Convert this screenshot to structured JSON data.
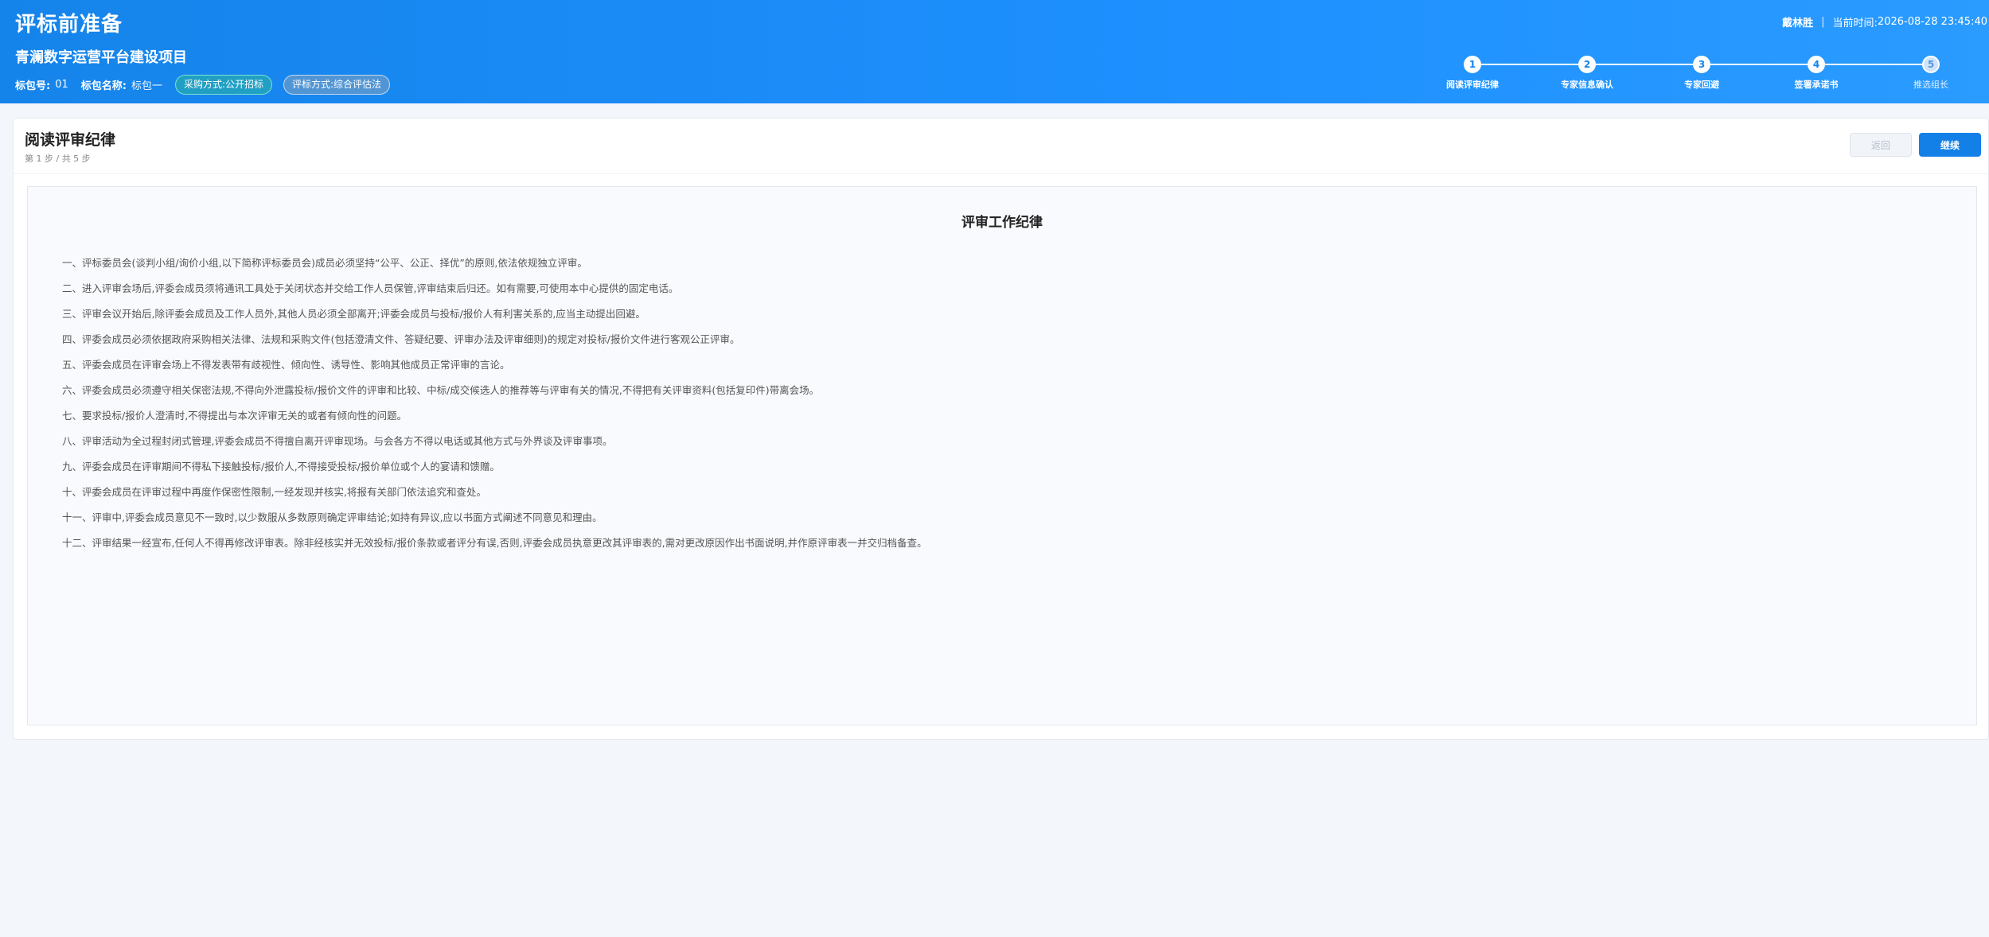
{
  "app": {
    "title": "评标前准备",
    "user": "戴林胜",
    "time_label": "当前时间:",
    "time_value": "2026-08-28 23:45:40"
  },
  "project": {
    "name": "青澜数字运营平台建设项目",
    "package_no_label": "标包号:",
    "package_no": "01",
    "package_name_label": "标包名称:",
    "package_name": "标包一",
    "procurement_method": "采购方式:公开招标",
    "evaluation_method": "评标方式:综合评估法"
  },
  "steps": [
    {
      "num": "1",
      "label": "阅读评审纪律",
      "state": "active"
    },
    {
      "num": "2",
      "label": "专家信息确认",
      "state": "active"
    },
    {
      "num": "3",
      "label": "专家回避",
      "state": "active"
    },
    {
      "num": "4",
      "label": "签署承诺书",
      "state": "active"
    },
    {
      "num": "5",
      "label": "推选组长",
      "state": "pending"
    }
  ],
  "card": {
    "title": "阅读评审纪律",
    "subtitle": "第 1 步 / 共 5 步",
    "back_label": "返回",
    "continue_label": "继续"
  },
  "document": {
    "title": "评审工作纪律",
    "rules": [
      "一、评标委员会(谈判小组/询价小组,以下简称评标委员会)成员必须坚持“公平、公正、择优”的原则,依法依规独立评审。",
      "二、进入评审会场后,评委会成员须将通讯工具处于关闭状态并交给工作人员保管,评审结束后归还。如有需要,可使用本中心提供的固定电话。",
      "三、评审会议开始后,除评委会成员及工作人员外,其他人员必须全部离开;评委会成员与投标/报价人有利害关系的,应当主动提出回避。",
      "四、评委会成员必须依据政府采购相关法律、法规和采购文件(包括澄清文件、答疑纪要、评审办法及评审细则)的规定对投标/报价文件进行客观公正评审。",
      "五、评委会成员在评审会场上不得发表带有歧视性、倾向性、诱导性、影响其他成员正常评审的言论。",
      "六、评委会成员必须遵守相关保密法规,不得向外泄露投标/报价文件的评审和比较、中标/成交候选人的推荐等与评审有关的情况,不得把有关评审资料(包括复印件)带离会场。",
      "七、要求投标/报价人澄清时,不得提出与本次评审无关的或者有倾向性的问题。",
      "八、评审活动为全过程封闭式管理,评委会成员不得擅自离开评审现场。与会各方不得以电话或其他方式与外界谈及评审事项。",
      "九、评委会成员在评审期间不得私下接触投标/报价人,不得接受投标/报价单位或个人的宴请和馈赠。",
      "十、评委会成员在评审过程中再度作保密性限制,一经发现并核实,将报有关部门依法追究和查处。",
      "十一、评审中,评委会成员意见不一致时,以少数服从多数原则确定评审结论;如持有异议,应以书面方式阐述不同意见和理由。",
      "十二、评审结果一经宣布,任何人不得再修改评审表。除非经核实并无效投标/报价条款或者评分有误,否则,评委会成员执意更改其评审表的,需对更改原因作出书面说明,并作原评审表一并交归档备查。"
    ]
  }
}
